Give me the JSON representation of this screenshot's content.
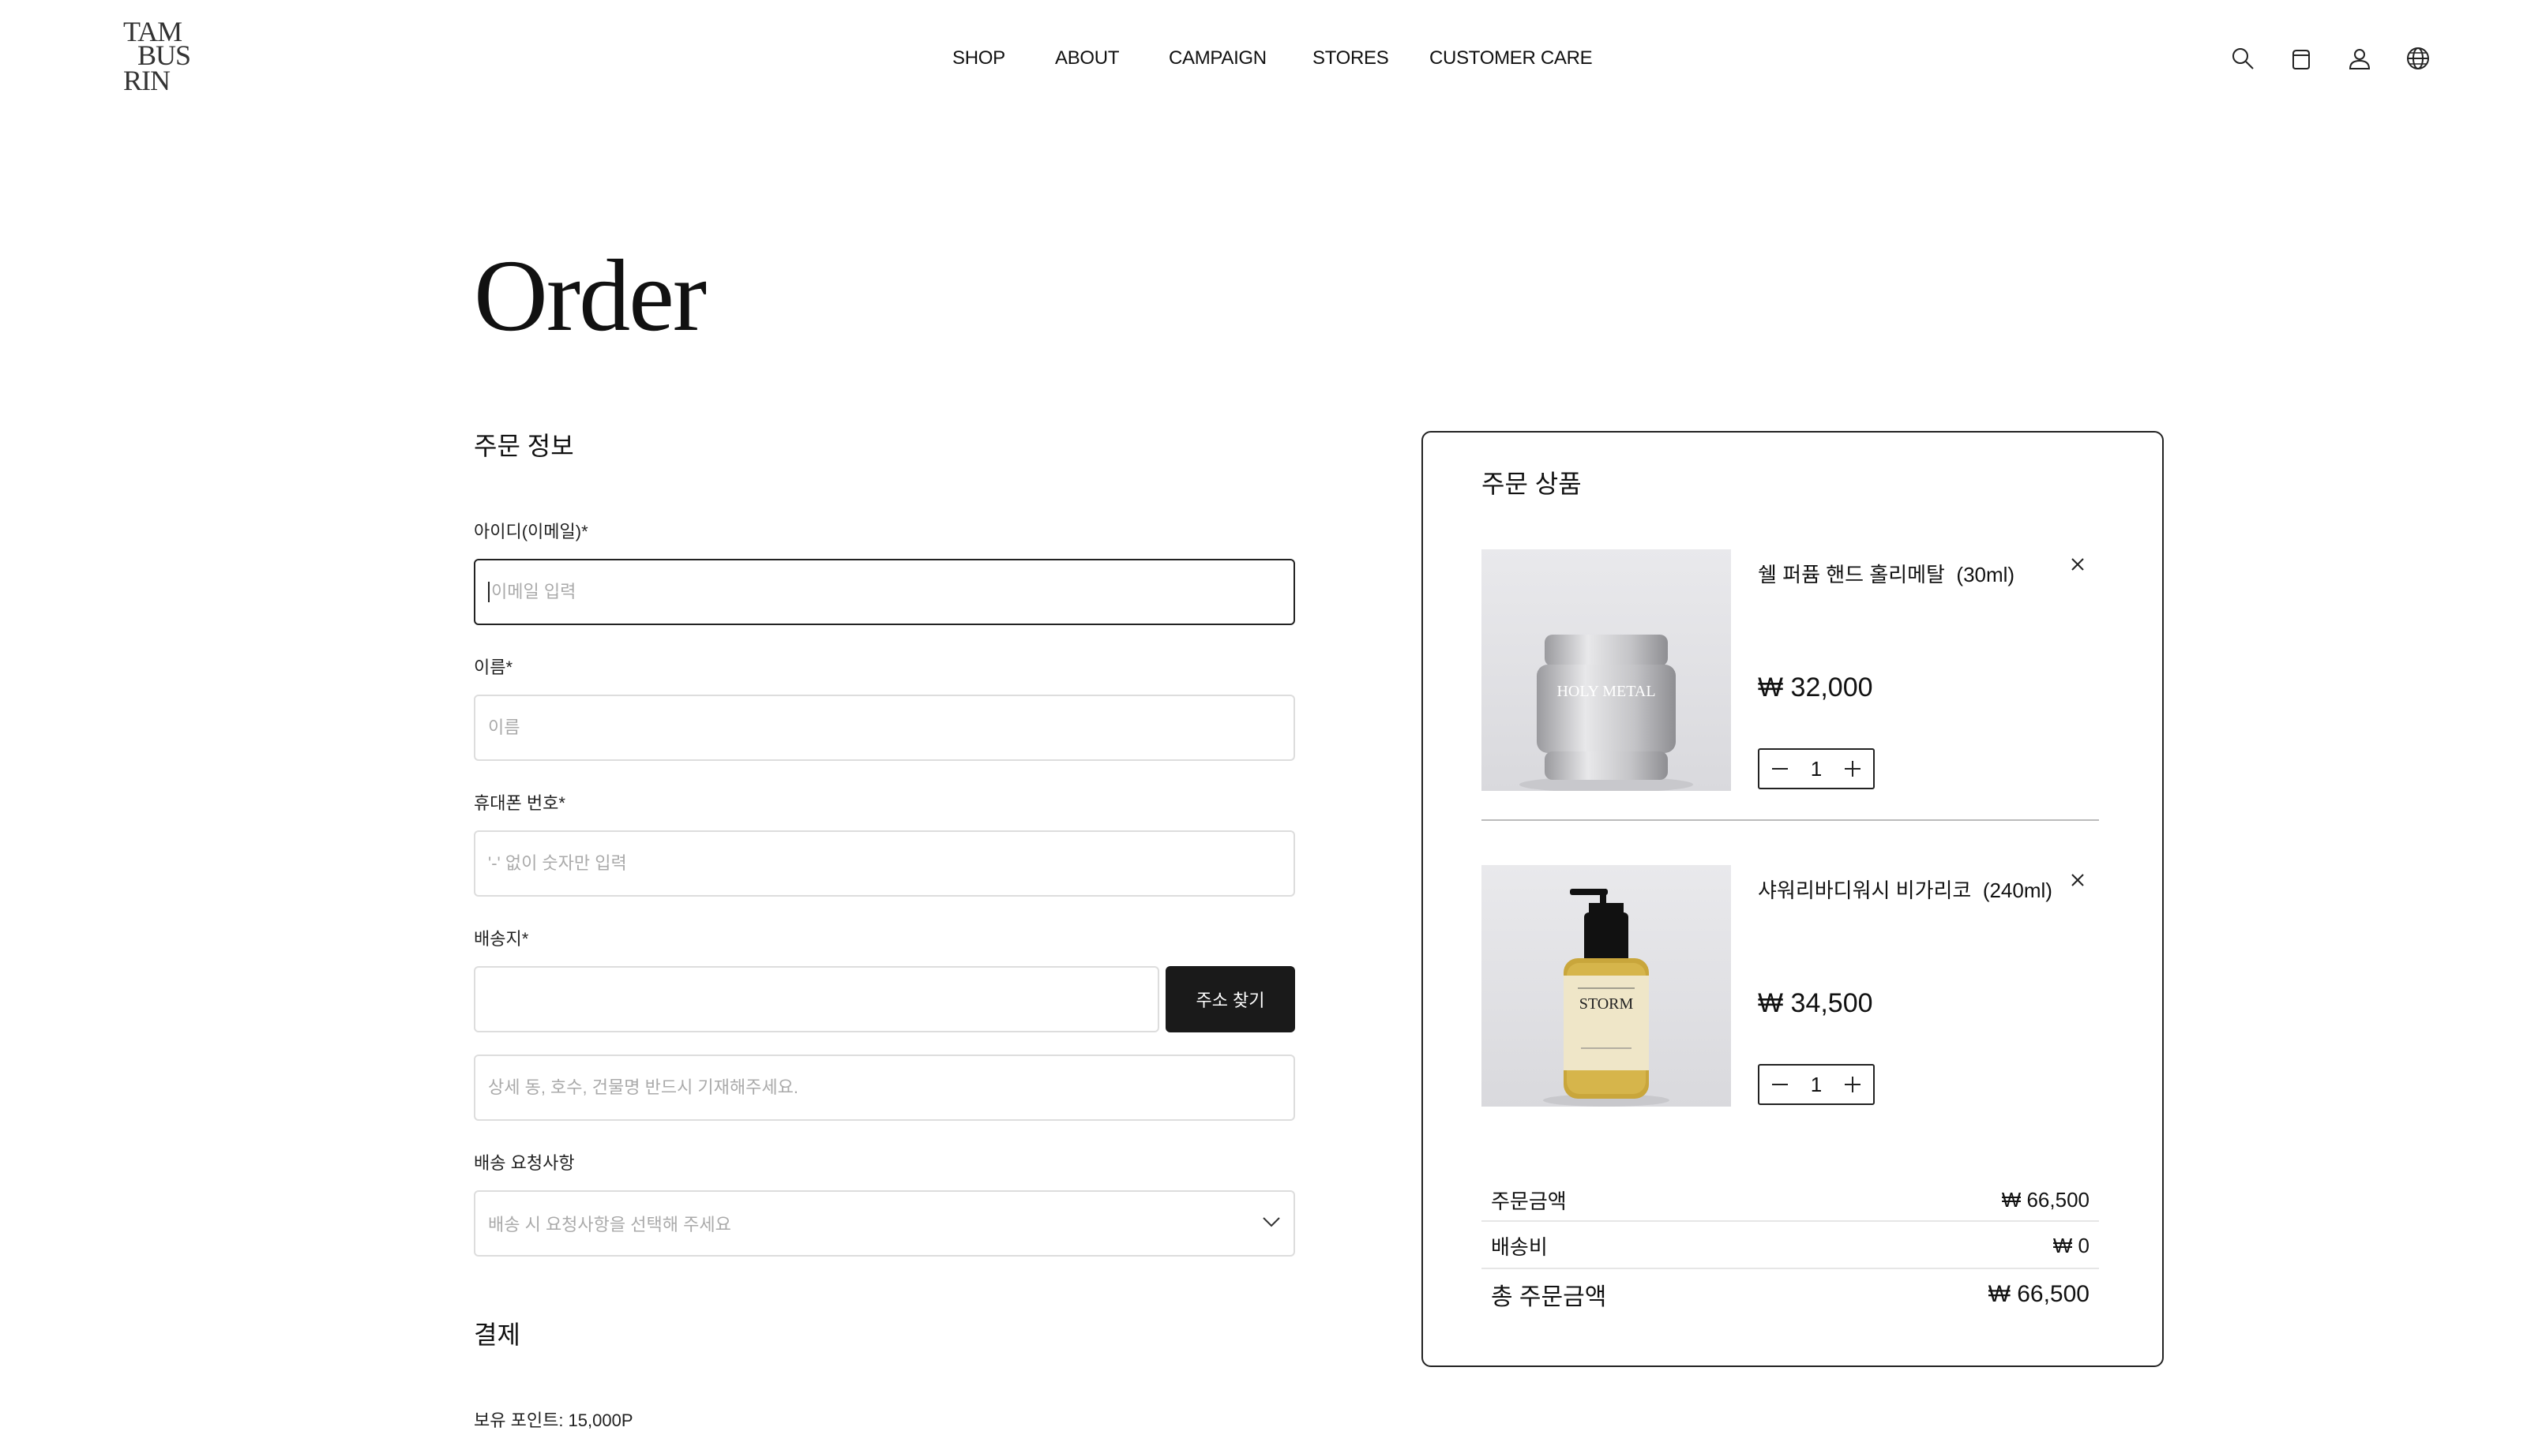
{
  "header": {
    "logo": {
      "line1": "TAM",
      "line2": "BUS",
      "line3": "RIN"
    },
    "nav": [
      "SHOP",
      "ABOUT",
      "CAMPAIGN",
      "STORES",
      "CUSTOMER CARE"
    ],
    "icons": [
      "search-icon",
      "cart-icon",
      "account-icon",
      "globe-icon"
    ]
  },
  "page": {
    "title": "Order"
  },
  "order_info": {
    "heading": "주문 정보",
    "email": {
      "label": "아이디(이메일)*",
      "placeholder": "이메일 입력",
      "value": ""
    },
    "name": {
      "label": "이름*",
      "placeholder": "이름",
      "value": ""
    },
    "phone": {
      "label": "휴대폰 번호*",
      "placeholder": "'-' 없이 숫자만 입력",
      "value": ""
    },
    "address": {
      "label": "배송지*",
      "value": "",
      "search_button": "주소 찾기",
      "detail_placeholder": "상세 동, 호수, 건물명 반드시 기재해주세요."
    },
    "delivery_request": {
      "label": "배송 요청사항",
      "placeholder": "배송 시 요청사항을 선택해 주세요"
    }
  },
  "payment": {
    "heading": "결제",
    "points_label": "보유 포인트: 15,000P"
  },
  "cart": {
    "heading": "주문 상품",
    "items": [
      {
        "name": "쉘 퍼퓸 핸드 홀리메탈",
        "volume": "(30ml)",
        "price": "₩ 32,000",
        "qty": "1",
        "image_label": "HOLY METAL"
      },
      {
        "name": "샤워리바디워시 비가리코",
        "volume": "(240ml)",
        "price": "₩ 34,500",
        "qty": "1",
        "image_label": "STORM"
      }
    ],
    "summary": {
      "subtotal_label": "주문금액",
      "subtotal": "₩ 66,500",
      "shipping_label": "배송비",
      "shipping": "₩ 0",
      "total_label": "총 주문금액",
      "total": "₩ 66,500"
    }
  }
}
